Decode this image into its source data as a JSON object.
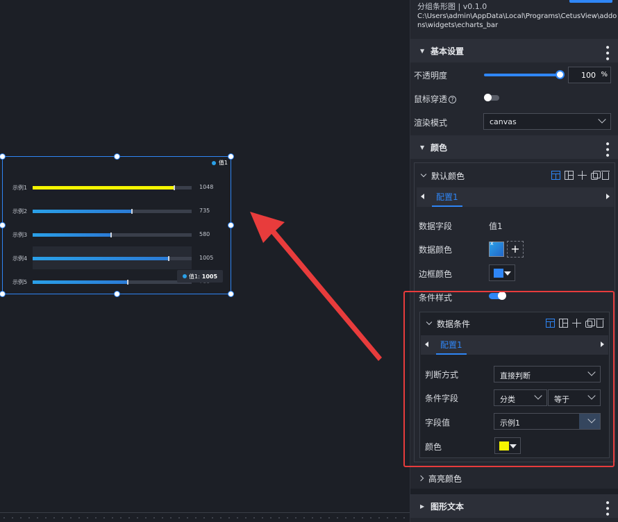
{
  "widget": {
    "legend_label": "值1",
    "tooltip_label": "值1:",
    "tooltip_value": "1005",
    "hidden_value": "700"
  },
  "chart_data": {
    "type": "bar",
    "categories": [
      "示例1",
      "示例2",
      "示例3",
      "示例4",
      "示例5"
    ],
    "values": [
      1048,
      735,
      580,
      1005,
      700
    ],
    "max": 1048,
    "highlight_color": "#f5f500",
    "bar_color": "#2aa0e8",
    "value_labels": [
      "1048",
      "735",
      "580",
      "1005",
      ""
    ]
  },
  "panel": {
    "title": "分组条形图 | v0.1.0",
    "path": "C:\\Users\\admin\\AppData\\Local\\Programs\\CetusView\\addons\\widgets\\echarts_bar",
    "basic": {
      "header": "基本设置",
      "opacity_label": "不透明度",
      "opacity_value": "100",
      "opacity_unit": "%",
      "passthrough_label": "鼠标穿透",
      "render_label": "渲染模式",
      "render_value": "canvas"
    },
    "color": {
      "header": "颜色",
      "default_color_header": "默认颜色",
      "tab": "配置1",
      "field_label": "数据字段",
      "field_value": "值1",
      "data_color_label": "数据颜色",
      "border_color_label": "边框颜色",
      "border_color": "#2f86f6",
      "cond_style_label": "条件样式",
      "condition": {
        "header": "数据条件",
        "tab": "配置1",
        "judge_label": "判断方式",
        "judge_value": "直接判断",
        "cond_field_label": "条件字段",
        "cond_field_value": "分类",
        "operator_value": "等于",
        "field_value_label": "字段值",
        "field_value_value": "示例1",
        "color_label": "颜色",
        "color": "#f5f500"
      },
      "highlight_header": "高亮颜色"
    },
    "graphic_text_header": "图形文本"
  }
}
